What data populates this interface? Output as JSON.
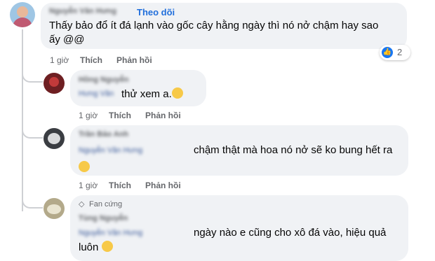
{
  "comments": [
    {
      "author": "Nguyễn Văn Hưng",
      "follow_label": "Theo dõi",
      "text_line1": "Thấy bảo đổ ít đá lạnh vào gốc cây hằng ngày thì nó nở chậm hay sao",
      "text_line2": "ấy @@",
      "reaction_count": "2",
      "time": "1 giờ",
      "like_label": "Thích",
      "reply_label": "Phản hồi"
    },
    {
      "author": "Hồng Nguyễn",
      "mention": "Hưng Văn",
      "text": "thử xem a.",
      "time": "1 giờ",
      "like_label": "Thích",
      "reply_label": "Phản hồi"
    },
    {
      "author": "Trần Bảo Anh",
      "mention": "Nguyễn Văn Hưng",
      "text": "chậm thật mà hoa nó nở sẽ ko bung hết ra",
      "time": "1 giờ",
      "like_label": "Thích",
      "reply_label": "Phản hồi"
    },
    {
      "badge": "Fan cứng",
      "author": "Tùng Nguyễn",
      "mention": "Nguyễn Văn Hưng",
      "text_line1": "ngày nào e cũng cho xô đá vào, hiệu quả",
      "text_line2": "luôn"
    }
  ]
}
